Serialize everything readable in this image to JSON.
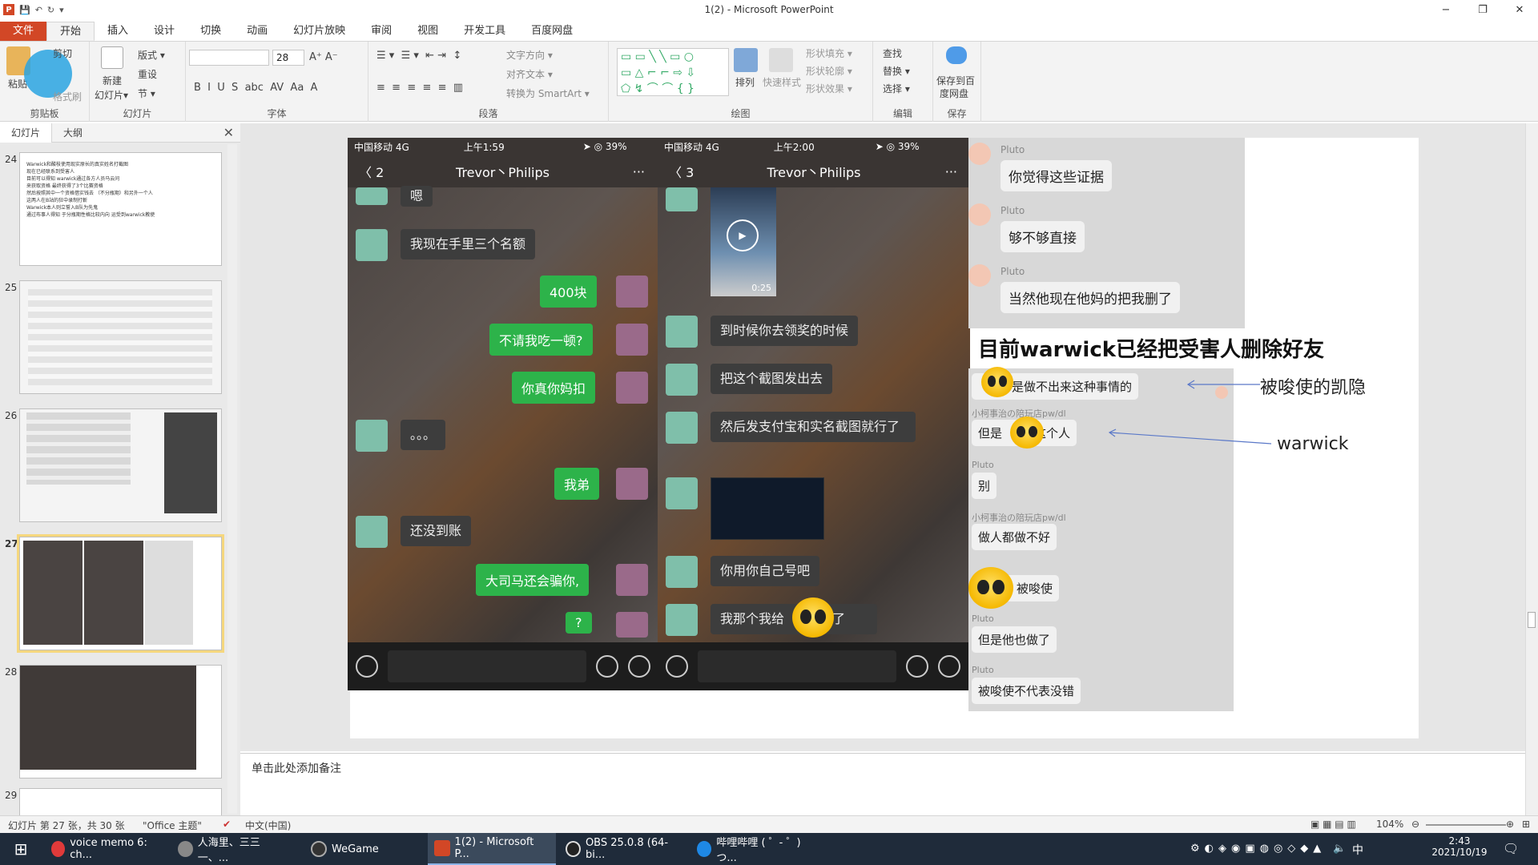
{
  "window": {
    "title": "1(2) - Microsoft PowerPoint",
    "controls": {
      "minimize": "−",
      "restore": "❐",
      "close": "✕"
    }
  },
  "tabs": [
    "文件",
    "开始",
    "插入",
    "设计",
    "切换",
    "动画",
    "幻灯片放映",
    "审阅",
    "视图",
    "开发工具",
    "百度网盘"
  ],
  "ribbon": {
    "groups": {
      "clipboard": "剪贴板",
      "slides": "幻灯片",
      "font": "字体",
      "paragraph": "段落",
      "drawing": "绘图",
      "editing": "编辑",
      "save": "保存"
    },
    "paste": "粘贴",
    "cut": "剪切",
    "format_painter": "格式刷",
    "new_slide": "新建",
    "new_slide2": "幻灯片▾",
    "layout": "版式 ▾",
    "reset": "重设",
    "section": "节 ▾",
    "font_size": "28",
    "text_direction": "文字方向 ▾",
    "align_text": "对齐文本 ▾",
    "smartart": "转换为 SmartArt ▾",
    "arrange": "排列",
    "quick_styles": "快速样式",
    "shape_fill": "形状填充 ▾",
    "shape_outline": "形状轮廓 ▾",
    "shape_effects": "形状效果 ▾",
    "find": "查找",
    "replace": "替换 ▾",
    "select": "选择 ▾",
    "save_baidu": "保存到百",
    "save_baidu2": "度网盘"
  },
  "panel": {
    "tab_slides": "幻灯片",
    "tab_outline": "大纲",
    "close": "✕"
  },
  "thumbnails": [
    "24",
    "25",
    "26",
    "27",
    "28",
    "29"
  ],
  "thumb24_text": [
    "Warwick和酸枝使用现实原长的真实姓名打截图",
    "现在已经联系到受害人",
    "目前可以得知 warwick通过各方人员马云问",
    "来获取资格 最终获得了3个比赛资格",
    "然后按照其中一个资格借实钱去 （不分瓶期）和另外一个人",
    "这两人在B站的狂中录制打斬",
    "Warwick本人则立誓入B队为先鬼",
    "通过布事人得知 于分瓶期性格比较内向 运受到warwick教使"
  ],
  "phone1": {
    "carrier": "中国移动  4G",
    "time": "上午1:59",
    "battery": "➤ ◎ 39%",
    "back_count": "2",
    "title": "Trevor丶Philips",
    "more": "···",
    "messages": [
      "嗯",
      "我现在手里三个名额",
      "400块",
      "不请我吃一顿?",
      "你真你妈扣",
      "。。。",
      "我弟",
      "还没到账",
      "大司马还会骗你,",
      "?"
    ]
  },
  "phone2": {
    "carrier": "中国移动  4G",
    "time": "上午2:00",
    "battery": "➤ ◎ 39%",
    "back_count": "3",
    "title": "Trevor丶Philips",
    "more": "···",
    "video_time": "0:25",
    "messages": [
      "到时候你去领奖的时候",
      "把这个截图发出去",
      "然后发支付宝和实名截图就行了",
      "你用你自己号吧",
      "我那个我给"
    ],
    "last_suffix": "了"
  },
  "qq": {
    "names": [
      "Pluto",
      "Pluto",
      "Pluto"
    ],
    "messages": [
      "你觉得这些证据",
      "够不够直接",
      "当然他现在他妈的把我删了"
    ]
  },
  "headline": "目前warwick已经把受害人删除好友",
  "lower_chat": {
    "msg1": "是做不出来这种事情的",
    "name2": "小柯事治の陪玩店pw/dl",
    "msg2a": "但是",
    "msg2b": "这个人",
    "name3": "Pluto",
    "msg3": "别",
    "name4": "小柯事治の陪玩店pw/dl",
    "msg4": "做人都做不好",
    "msg5": "被唆使",
    "name6": "Pluto",
    "msg6": "但是他也做了",
    "name7": "Pluto",
    "msg7": "被唆使不代表没错"
  },
  "annotations": {
    "kaiyin": "被唆使的凯隐",
    "warwick": "warwick"
  },
  "notes_placeholder": "单击此处添加备注",
  "status": {
    "slide_info": "幻灯片 第 27 张，共 30 张",
    "theme": "\"Office 主题\"",
    "language": "中文(中国)",
    "zoom": "104%"
  },
  "taskbar": {
    "items": [
      "voice memo 6: ch...",
      "人海里、三三一、...",
      "WeGame",
      "1(2) - Microsoft P...",
      "OBS 25.0.8 (64-bi...",
      "哔哩哔哩 ( ゜- ゜)つ..."
    ],
    "time": "2:43",
    "date": "2021/10/19",
    "ime": "中"
  },
  "colors": {
    "file_tab": "#d24726",
    "wechat_green": "#2db34a",
    "taskbar": "#1f2b3a",
    "selected_thumb": "#f5d77e"
  }
}
